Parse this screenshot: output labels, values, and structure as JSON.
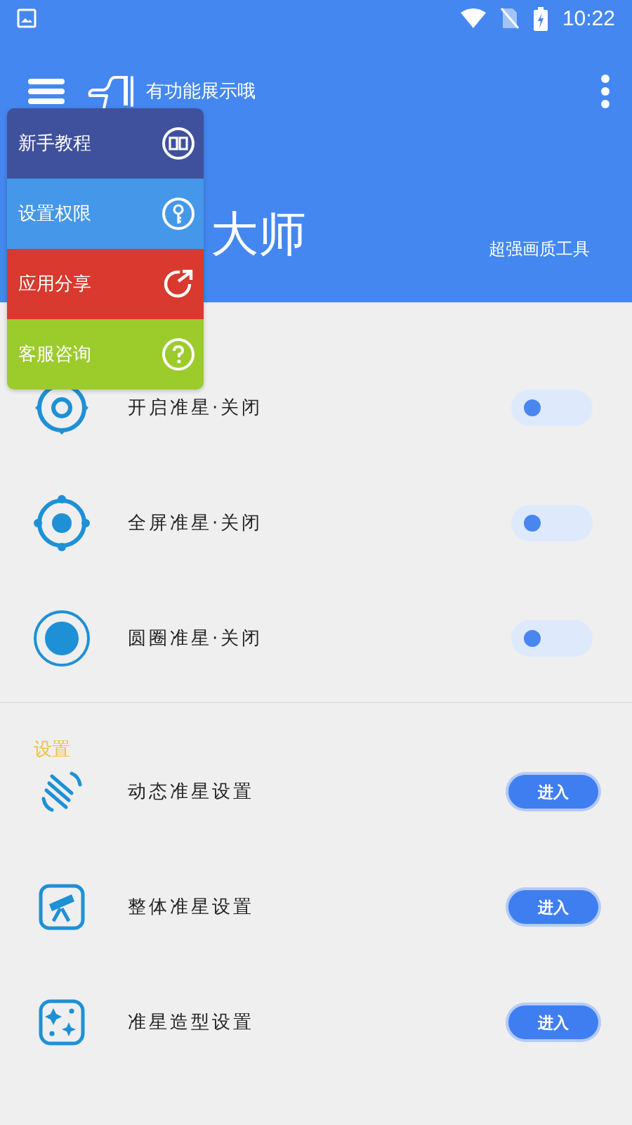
{
  "status_bar": {
    "time": "10:22"
  },
  "toolbar": {
    "hint": "有功能展示哦"
  },
  "header": {
    "title": "大师",
    "subtitle": "超强画质工具"
  },
  "menu": [
    {
      "label": "新手教程",
      "kind": "book",
      "color": "#3f519c"
    },
    {
      "label": "设置权限",
      "kind": "key",
      "color": "#4597e9"
    },
    {
      "label": "应用分享",
      "kind": "share",
      "color": "#d9392e"
    },
    {
      "label": "客服咨询",
      "kind": "help",
      "color": "#9ccb2c"
    }
  ],
  "toggles": [
    {
      "label": "开启准星·关闭",
      "kind": "ring",
      "on": false
    },
    {
      "label": "全屏准星·关闭",
      "kind": "dot",
      "on": false
    },
    {
      "label": "圆圈准星·关闭",
      "kind": "circle",
      "on": false
    }
  ],
  "settings_section": {
    "title": "设置"
  },
  "settings": [
    {
      "label": "动态准星设置",
      "kind": "dynamic",
      "button": "进入"
    },
    {
      "label": "整体准星设置",
      "kind": "telescope",
      "button": "进入"
    },
    {
      "label": "准星造型设置",
      "kind": "sparkle",
      "button": "进入"
    }
  ]
}
